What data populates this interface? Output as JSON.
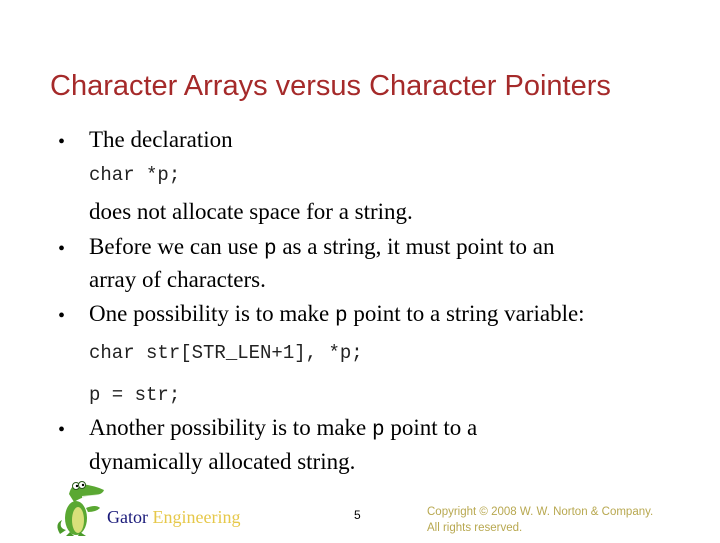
{
  "slide": {
    "title": "Character Arrays versus Character Pointers",
    "bullet_glyph": "•",
    "b1": {
      "text": "The declaration",
      "code": "char *p;",
      "cont": "does not allocate space for a string."
    },
    "b2": {
      "pre": "Before we can use ",
      "code": "p",
      "post": " as a string, it must point to an",
      "line2": "array of characters."
    },
    "b3": {
      "pre": "One possibility is to make ",
      "code": "p",
      "post": " point to a string variable:",
      "code1": "char str[STR_LEN+1], *p;",
      "code2": "p = str;"
    },
    "b4": {
      "pre": "Another possibility is to make ",
      "code": "p",
      "post": " point to a",
      "line2": "dynamically allocated string."
    }
  },
  "footer": {
    "logo_icon": "gator-mascot-icon",
    "brand_word1": "Gator",
    "brand_word2": "Engineering",
    "page_number": "5",
    "copyright_line1": "Copyright © 2008 W. W. Norton & Company.",
    "copyright_line2": "All rights reserved."
  }
}
